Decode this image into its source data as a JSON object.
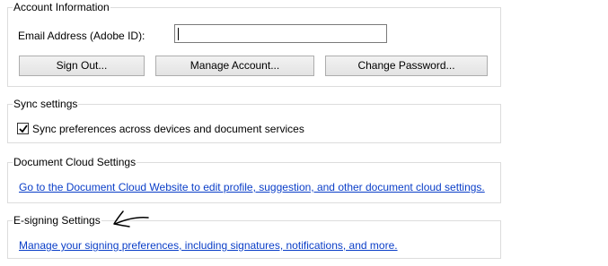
{
  "account": {
    "title": "Account Information",
    "email_label": "Email Address (Adobe ID):",
    "email_value": "",
    "buttons": {
      "sign_out": "Sign Out...",
      "manage_account": "Manage Account...",
      "change_password": "Change Password..."
    }
  },
  "sync": {
    "title": "Sync settings",
    "checkbox_label": "Sync preferences across devices and document services",
    "checked": true
  },
  "cloud": {
    "title": "Document Cloud Settings",
    "link": "Go to the Document Cloud Website to edit profile, suggestion, and other document cloud settings."
  },
  "esign": {
    "title": "E-signing Settings",
    "link": "Manage your signing preferences, including signatures, notifications, and more."
  },
  "annotation": {
    "icon": "hand-drawn-arrow-icon",
    "color": "#000000"
  },
  "colors": {
    "link": "#0a3ec8",
    "group_border": "#dcdcdc"
  }
}
